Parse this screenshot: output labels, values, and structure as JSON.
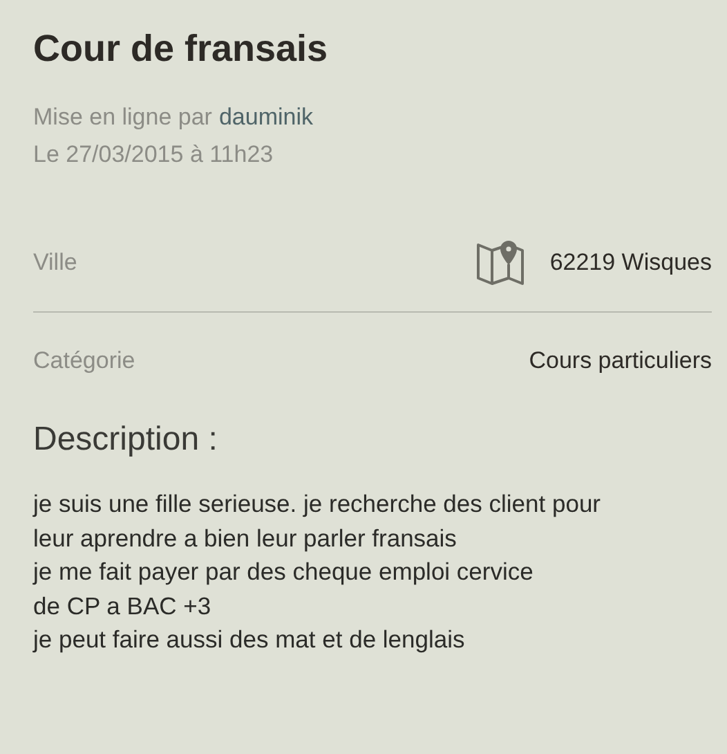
{
  "title": "Cour de fransais",
  "posted": {
    "prefix": "Mise en ligne par",
    "author": "dauminik",
    "date": "Le 27/03/2015 à 11h23"
  },
  "details": [
    {
      "kind": "location",
      "label": "Ville",
      "value": "62219 Wisques"
    },
    {
      "kind": "plain",
      "label": "Catégorie",
      "value": "Cours particuliers"
    }
  ],
  "description": {
    "heading": "Description :",
    "text": "je suis une fille serieuse. je recherche des client pour\nleur aprendre a bien leur parler fransais\nje me fait payer par des cheque emploi cervice\nde CP a BAC +3\nje peut faire aussi des mat et de lenglais"
  }
}
